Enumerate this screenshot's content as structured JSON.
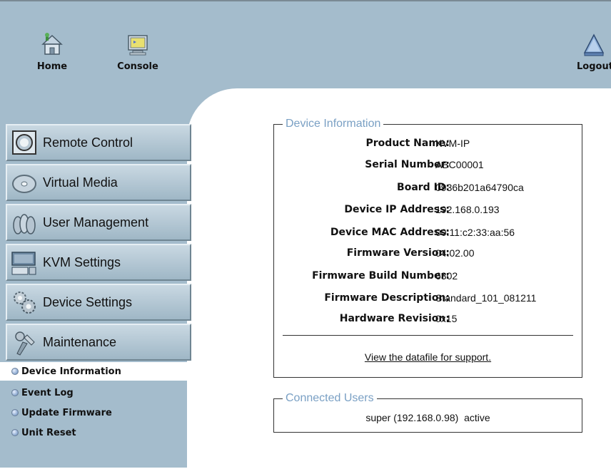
{
  "toolbar": {
    "home_label": "Home",
    "console_label": "Console",
    "logout_label": "Logout"
  },
  "nav": {
    "buttons": [
      {
        "label": "Remote Control",
        "icon": "monitor-icon"
      },
      {
        "label": "Virtual Media",
        "icon": "disc-icon"
      },
      {
        "label": "User Management",
        "icon": "users-icon"
      },
      {
        "label": "KVM Settings",
        "icon": "kvm-icon"
      },
      {
        "label": "Device Settings",
        "icon": "gears-icon"
      },
      {
        "label": "Maintenance",
        "icon": "tools-icon"
      }
    ],
    "sub_items": [
      {
        "label": "Device Information",
        "active": true
      },
      {
        "label": "Event Log",
        "active": false
      },
      {
        "label": "Update Firmware",
        "active": false
      },
      {
        "label": "Unit Reset",
        "active": false
      }
    ]
  },
  "device_info": {
    "legend": "Device Information",
    "rows": [
      {
        "label": "Product Name:",
        "value": "KVM-IP"
      },
      {
        "label": "Serial Number:",
        "value": "ABC00001"
      },
      {
        "label": "Board ID:",
        "value": "0936b201a64790ca"
      },
      {
        "label": "Device IP Address:",
        "value": "192.168.0.193"
      },
      {
        "label": "Device MAC Address:",
        "value": "00:11:c2:33:aa:56"
      },
      {
        "label": "Firmware Version:",
        "value": "04.02.00"
      },
      {
        "label": "Firmware Build Number:",
        "value": "6302"
      },
      {
        "label": "Firmware Description:",
        "value": "Standard_101_081211"
      },
      {
        "label": "Hardware Revision:",
        "value": "0x15"
      }
    ],
    "datafile_link": "View the datafile for support."
  },
  "connected_users": {
    "legend": "Connected Users",
    "entry": "super (192.168.0.98)  active"
  },
  "colors": {
    "frame_bg": "#a4bccc",
    "legend_text": "#7aa0c4",
    "content_bg": "#ffffff"
  }
}
